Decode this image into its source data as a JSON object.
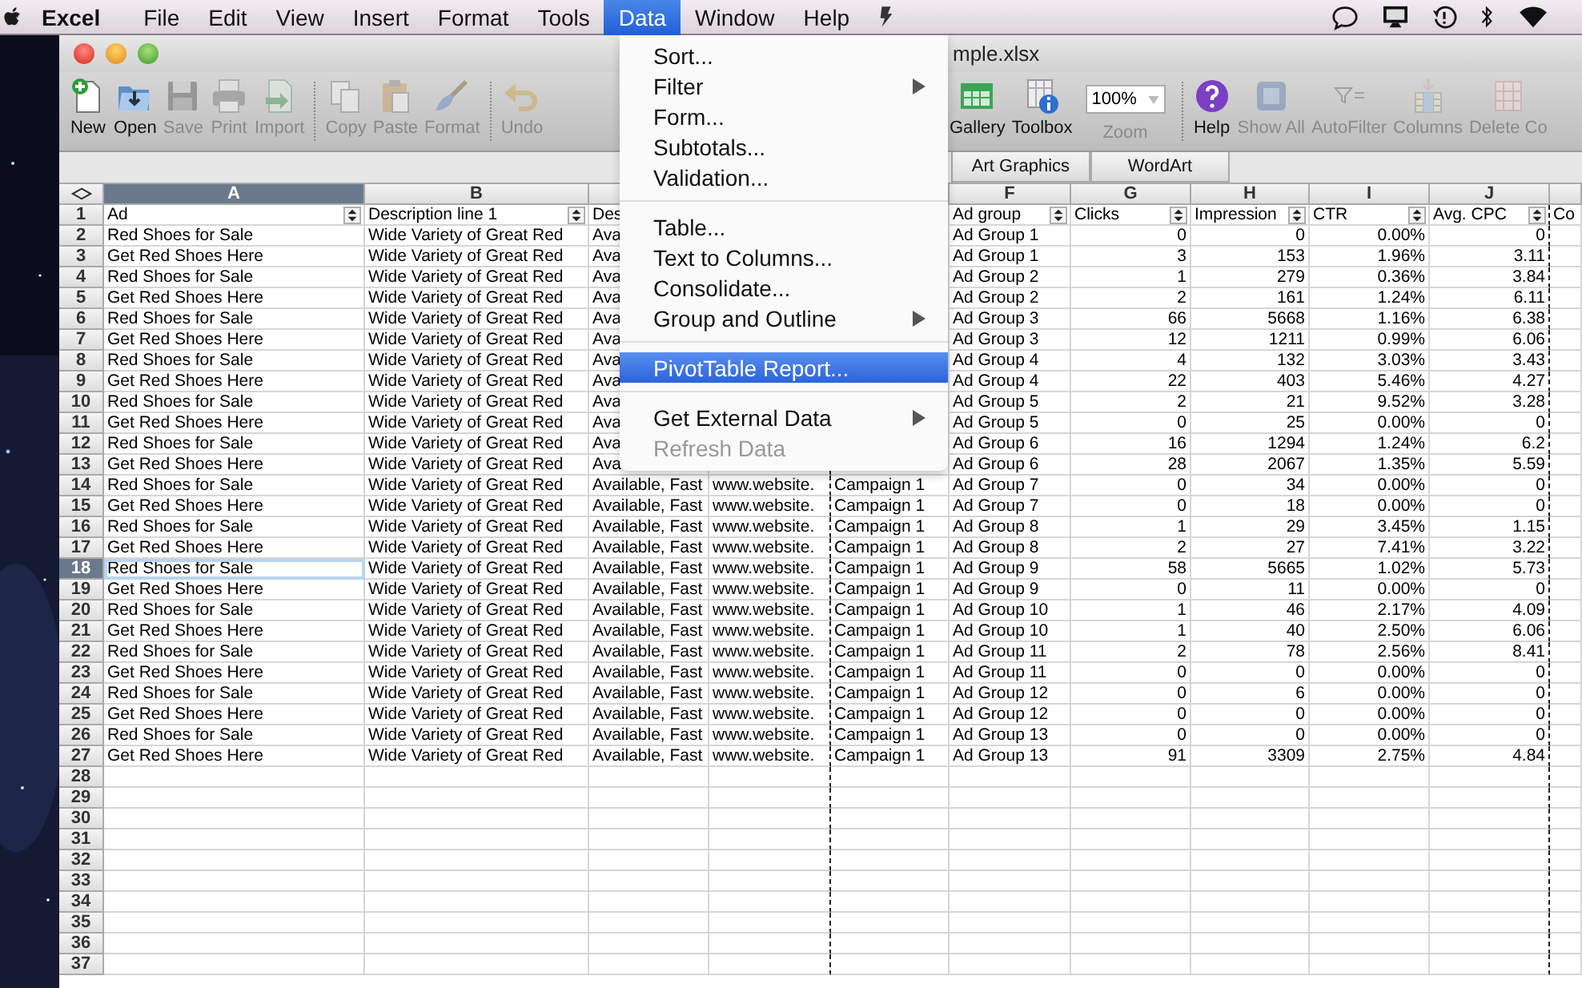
{
  "menu_bar": {
    "app": "Excel",
    "items": [
      {
        "label": "File",
        "selected": false
      },
      {
        "label": "Edit",
        "selected": false
      },
      {
        "label": "View",
        "selected": false
      },
      {
        "label": "Insert",
        "selected": false
      },
      {
        "label": "Format",
        "selected": false
      },
      {
        "label": "Tools",
        "selected": false
      },
      {
        "label": "Data",
        "selected": true
      },
      {
        "label": "Window",
        "selected": false
      },
      {
        "label": "Help",
        "selected": false
      }
    ]
  },
  "data_menu": {
    "items": [
      {
        "kind": "item",
        "label": "Sort...",
        "submenu": false,
        "disabled": false,
        "selected": false
      },
      {
        "kind": "item",
        "label": "Filter",
        "submenu": true,
        "disabled": false,
        "selected": false
      },
      {
        "kind": "item",
        "label": "Form...",
        "submenu": false,
        "disabled": false,
        "selected": false
      },
      {
        "kind": "item",
        "label": "Subtotals...",
        "submenu": false,
        "disabled": false,
        "selected": false
      },
      {
        "kind": "item",
        "label": "Validation...",
        "submenu": false,
        "disabled": false,
        "selected": false
      },
      {
        "kind": "separator"
      },
      {
        "kind": "item",
        "label": "Table...",
        "submenu": false,
        "disabled": false,
        "selected": false
      },
      {
        "kind": "item",
        "label": "Text to Columns...",
        "submenu": false,
        "disabled": false,
        "selected": false
      },
      {
        "kind": "item",
        "label": "Consolidate...",
        "submenu": false,
        "disabled": false,
        "selected": false
      },
      {
        "kind": "item",
        "label": "Group and Outline",
        "submenu": true,
        "disabled": false,
        "selected": false
      },
      {
        "kind": "separator"
      },
      {
        "kind": "item",
        "label": "PivotTable Report...",
        "submenu": false,
        "disabled": false,
        "selected": true
      },
      {
        "kind": "separator"
      },
      {
        "kind": "item",
        "label": "Get External Data",
        "submenu": true,
        "disabled": false,
        "selected": false
      },
      {
        "kind": "item",
        "label": "Refresh Data",
        "submenu": false,
        "disabled": true,
        "selected": false
      }
    ]
  },
  "window": {
    "title": "mple.xlsx"
  },
  "toolbar": {
    "left_items": [
      {
        "kind": "button",
        "label": "New",
        "disabled": false
      },
      {
        "kind": "button",
        "label": "Open",
        "disabled": false
      },
      {
        "kind": "button",
        "label": "Save",
        "disabled": true
      },
      {
        "kind": "button",
        "label": "Print",
        "disabled": true
      },
      {
        "kind": "button",
        "label": "Import",
        "disabled": true
      },
      {
        "kind": "separator"
      },
      {
        "kind": "button",
        "label": "Copy",
        "disabled": true
      },
      {
        "kind": "button",
        "label": "Paste",
        "disabled": true
      },
      {
        "kind": "button",
        "label": "Format",
        "disabled": true
      },
      {
        "kind": "separator"
      },
      {
        "kind": "button",
        "label": "Undo",
        "disabled": true
      }
    ],
    "right_items": [
      {
        "kind": "button",
        "label": "Gallery",
        "disabled": false
      },
      {
        "kind": "button",
        "label": "Toolbox",
        "disabled": false
      },
      {
        "kind": "zoom",
        "value": "100%",
        "label": "Zoom",
        "disabled": true
      },
      {
        "kind": "separator"
      },
      {
        "kind": "button",
        "label": "Help",
        "disabled": false
      },
      {
        "kind": "button",
        "label": "Show All",
        "disabled": true
      },
      {
        "kind": "button",
        "label": "AutoFilter",
        "disabled": true
      },
      {
        "kind": "button",
        "label": "Columns",
        "disabled": true
      },
      {
        "kind": "button",
        "label": "Delete Co",
        "disabled": true
      }
    ]
  },
  "ribbon_tabs": [
    {
      "label": "Art Graphics",
      "selected": false
    },
    {
      "label": "WordArt",
      "selected": false
    }
  ],
  "sheet": {
    "columns": [
      {
        "kind": "letter",
        "letter": "A",
        "selected": true
      },
      {
        "kind": "letter",
        "letter": "B",
        "selected": false
      },
      {
        "kind": "covered"
      },
      {
        "kind": "hidden"
      },
      {
        "kind": "covered"
      },
      {
        "kind": "letter",
        "letter": "F",
        "selected": false
      },
      {
        "kind": "letter",
        "letter": "G",
        "selected": false
      },
      {
        "kind": "letter",
        "letter": "H",
        "selected": false
      },
      {
        "kind": "letter",
        "letter": "I",
        "selected": false
      },
      {
        "kind": "letter",
        "letter": "J",
        "selected": false
      },
      {
        "kind": "covered"
      }
    ],
    "header_row": {
      "row": "1",
      "selected": false,
      "ad": {
        "text": "Ad",
        "filter_button": true
      },
      "description_line_1": {
        "text": "Description line 1",
        "filter_button": true
      },
      "column_c": {
        "text": "Des"
      },
      "ad_group": {
        "text": "Ad group",
        "filter_button": true
      },
      "clicks": {
        "text": "Clicks",
        "filter_button": true
      },
      "impressions": {
        "text": "Impression",
        "filter_button": true
      },
      "ctr": {
        "text": "CTR",
        "filter_button": true
      },
      "avg_cpc": {
        "text": "Avg. CPC",
        "filter_button": true
      },
      "column_k": {
        "text": "Co"
      }
    },
    "rows": [
      {
        "row": "2",
        "selected": false,
        "ad": "Red Shoes for Sale",
        "description_line_1": "Wide Variety of Great Red",
        "column_c": "Ava",
        "ad_group": "Ad Group 1",
        "clicks": "0",
        "impressions": "0",
        "ctr": "0.00%",
        "avg_cpc": "0"
      },
      {
        "row": "3",
        "selected": false,
        "ad": "Get Red Shoes Here",
        "description_line_1": "Wide Variety of Great Red",
        "column_c": "Ava",
        "ad_group": "Ad Group 1",
        "clicks": "3",
        "impressions": "153",
        "ctr": "1.96%",
        "avg_cpc": "3.11"
      },
      {
        "row": "4",
        "selected": false,
        "ad": "Red Shoes for Sale",
        "description_line_1": "Wide Variety of Great Red",
        "column_c": "Ava",
        "ad_group": "Ad Group 2",
        "clicks": "1",
        "impressions": "279",
        "ctr": "0.36%",
        "avg_cpc": "3.84"
      },
      {
        "row": "5",
        "selected": false,
        "ad": "Get Red Shoes Here",
        "description_line_1": "Wide Variety of Great Red",
        "column_c": "Ava",
        "ad_group": "Ad Group 2",
        "clicks": "2",
        "impressions": "161",
        "ctr": "1.24%",
        "avg_cpc": "6.11"
      },
      {
        "row": "6",
        "selected": false,
        "ad": "Red Shoes for Sale",
        "description_line_1": "Wide Variety of Great Red",
        "column_c": "Ava",
        "ad_group": "Ad Group 3",
        "clicks": "66",
        "impressions": "5668",
        "ctr": "1.16%",
        "avg_cpc": "6.38"
      },
      {
        "row": "7",
        "selected": false,
        "ad": "Get Red Shoes Here",
        "description_line_1": "Wide Variety of Great Red",
        "column_c": "Ava",
        "ad_group": "Ad Group 3",
        "clicks": "12",
        "impressions": "1211",
        "ctr": "0.99%",
        "avg_cpc": "6.06"
      },
      {
        "row": "8",
        "selected": false,
        "ad": "Red Shoes for Sale",
        "description_line_1": "Wide Variety of Great Red",
        "column_c": "Ava",
        "ad_group": "Ad Group 4",
        "clicks": "4",
        "impressions": "132",
        "ctr": "3.03%",
        "avg_cpc": "3.43"
      },
      {
        "row": "9",
        "selected": false,
        "ad": "Get Red Shoes Here",
        "description_line_1": "Wide Variety of Great Red",
        "column_c": "Ava",
        "ad_group": "Ad Group 4",
        "clicks": "22",
        "impressions": "403",
        "ctr": "5.46%",
        "avg_cpc": "4.27"
      },
      {
        "row": "10",
        "selected": false,
        "ad": "Red Shoes for Sale",
        "description_line_1": "Wide Variety of Great Red",
        "column_c": "Ava",
        "ad_group": "Ad Group 5",
        "clicks": "2",
        "impressions": "21",
        "ctr": "9.52%",
        "avg_cpc": "3.28"
      },
      {
        "row": "11",
        "selected": false,
        "ad": "Get Red Shoes Here",
        "description_line_1": "Wide Variety of Great Red",
        "column_c": "Ava",
        "ad_group": "Ad Group 5",
        "clicks": "0",
        "impressions": "25",
        "ctr": "0.00%",
        "avg_cpc": "0"
      },
      {
        "row": "12",
        "selected": false,
        "ad": "Red Shoes for Sale",
        "description_line_1": "Wide Variety of Great Red",
        "column_c": "Ava",
        "ad_group": "Ad Group 6",
        "clicks": "16",
        "impressions": "1294",
        "ctr": "1.24%",
        "avg_cpc": "6.2"
      },
      {
        "row": "13",
        "selected": false,
        "ad": "Get Red Shoes Here",
        "description_line_1": "Wide Variety of Great Red",
        "column_c": "Ava",
        "ad_group": "Ad Group 6",
        "clicks": "28",
        "impressions": "2067",
        "ctr": "1.35%",
        "avg_cpc": "5.59"
      },
      {
        "row": "14",
        "selected": false,
        "ad": "Red Shoes for Sale",
        "description_line_1": "Wide Variety of Great Red",
        "column_c": "Available, Fast",
        "column_d": "www.website.",
        "column_e": "Campaign 1",
        "ad_group": "Ad Group 7",
        "clicks": "0",
        "impressions": "34",
        "ctr": "0.00%",
        "avg_cpc": "0"
      },
      {
        "row": "15",
        "selected": false,
        "ad": "Get Red Shoes Here",
        "description_line_1": "Wide Variety of Great Red",
        "column_c": "Available, Fast",
        "column_d": "www.website.",
        "column_e": "Campaign 1",
        "ad_group": "Ad Group 7",
        "clicks": "0",
        "impressions": "18",
        "ctr": "0.00%",
        "avg_cpc": "0"
      },
      {
        "row": "16",
        "selected": false,
        "ad": "Red Shoes for Sale",
        "description_line_1": "Wide Variety of Great Red",
        "column_c": "Available, Fast",
        "column_d": "www.website.",
        "column_e": "Campaign 1",
        "ad_group": "Ad Group 8",
        "clicks": "1",
        "impressions": "29",
        "ctr": "3.45%",
        "avg_cpc": "1.15"
      },
      {
        "row": "17",
        "selected": false,
        "ad": "Get Red Shoes Here",
        "description_line_1": "Wide Variety of Great Red",
        "column_c": "Available, Fast",
        "column_d": "www.website.",
        "column_e": "Campaign 1",
        "ad_group": "Ad Group 8",
        "clicks": "2",
        "impressions": "27",
        "ctr": "7.41%",
        "avg_cpc": "3.22"
      },
      {
        "row": "18",
        "selected": true,
        "ad": "Red Shoes for Sale",
        "description_line_1": "Wide Variety of Great Red",
        "column_c": "Available, Fast",
        "column_d": "www.website.",
        "column_e": "Campaign 1",
        "ad_group": "Ad Group 9",
        "clicks": "58",
        "impressions": "5665",
        "ctr": "1.02%",
        "avg_cpc": "5.73"
      },
      {
        "row": "19",
        "selected": false,
        "ad": "Get Red Shoes Here",
        "description_line_1": "Wide Variety of Great Red",
        "column_c": "Available, Fast",
        "column_d": "www.website.",
        "column_e": "Campaign 1",
        "ad_group": "Ad Group 9",
        "clicks": "0",
        "impressions": "11",
        "ctr": "0.00%",
        "avg_cpc": "0"
      },
      {
        "row": "20",
        "selected": false,
        "ad": "Red Shoes for Sale",
        "description_line_1": "Wide Variety of Great Red",
        "column_c": "Available, Fast",
        "column_d": "www.website.",
        "column_e": "Campaign 1",
        "ad_group": "Ad Group 10",
        "clicks": "1",
        "impressions": "46",
        "ctr": "2.17%",
        "avg_cpc": "4.09"
      },
      {
        "row": "21",
        "selected": false,
        "ad": "Get Red Shoes Here",
        "description_line_1": "Wide Variety of Great Red",
        "column_c": "Available, Fast",
        "column_d": "www.website.",
        "column_e": "Campaign 1",
        "ad_group": "Ad Group 10",
        "clicks": "1",
        "impressions": "40",
        "ctr": "2.50%",
        "avg_cpc": "6.06"
      },
      {
        "row": "22",
        "selected": false,
        "ad": "Red Shoes for Sale",
        "description_line_1": "Wide Variety of Great Red",
        "column_c": "Available, Fast",
        "column_d": "www.website.",
        "column_e": "Campaign 1",
        "ad_group": "Ad Group 11",
        "clicks": "2",
        "impressions": "78",
        "ctr": "2.56%",
        "avg_cpc": "8.41"
      },
      {
        "row": "23",
        "selected": false,
        "ad": "Get Red Shoes Here",
        "description_line_1": "Wide Variety of Great Red",
        "column_c": "Available, Fast",
        "column_d": "www.website.",
        "column_e": "Campaign 1",
        "ad_group": "Ad Group 11",
        "clicks": "0",
        "impressions": "0",
        "ctr": "0.00%",
        "avg_cpc": "0"
      },
      {
        "row": "24",
        "selected": false,
        "ad": "Red Shoes for Sale",
        "description_line_1": "Wide Variety of Great Red",
        "column_c": "Available, Fast",
        "column_d": "www.website.",
        "column_e": "Campaign 1",
        "ad_group": "Ad Group 12",
        "clicks": "0",
        "impressions": "6",
        "ctr": "0.00%",
        "avg_cpc": "0"
      },
      {
        "row": "25",
        "selected": false,
        "ad": "Get Red Shoes Here",
        "description_line_1": "Wide Variety of Great Red",
        "column_c": "Available, Fast",
        "column_d": "www.website.",
        "column_e": "Campaign 1",
        "ad_group": "Ad Group 12",
        "clicks": "0",
        "impressions": "0",
        "ctr": "0.00%",
        "avg_cpc": "0"
      },
      {
        "row": "26",
        "selected": false,
        "ad": "Red Shoes for Sale",
        "description_line_1": "Wide Variety of Great Red",
        "column_c": "Available, Fast",
        "column_d": "www.website.",
        "column_e": "Campaign 1",
        "ad_group": "Ad Group 13",
        "clicks": "0",
        "impressions": "0",
        "ctr": "0.00%",
        "avg_cpc": "0"
      },
      {
        "row": "27",
        "selected": false,
        "ad": "Get Red Shoes Here",
        "description_line_1": "Wide Variety of Great Red",
        "column_c": "Available, Fast",
        "column_d": "www.website.",
        "column_e": "Campaign 1",
        "ad_group": "Ad Group 13",
        "clicks": "91",
        "impressions": "3309",
        "ctr": "2.75%",
        "avg_cpc": "4.84"
      },
      {
        "row": "28",
        "selected": false
      },
      {
        "row": "29",
        "selected": false
      },
      {
        "row": "30",
        "selected": false
      },
      {
        "row": "31",
        "selected": false
      },
      {
        "row": "32",
        "selected": false
      },
      {
        "row": "33",
        "selected": false
      },
      {
        "row": "34",
        "selected": false
      },
      {
        "row": "35",
        "selected": false
      },
      {
        "row": "36",
        "selected": false
      },
      {
        "row": "37",
        "selected": false
      }
    ]
  }
}
